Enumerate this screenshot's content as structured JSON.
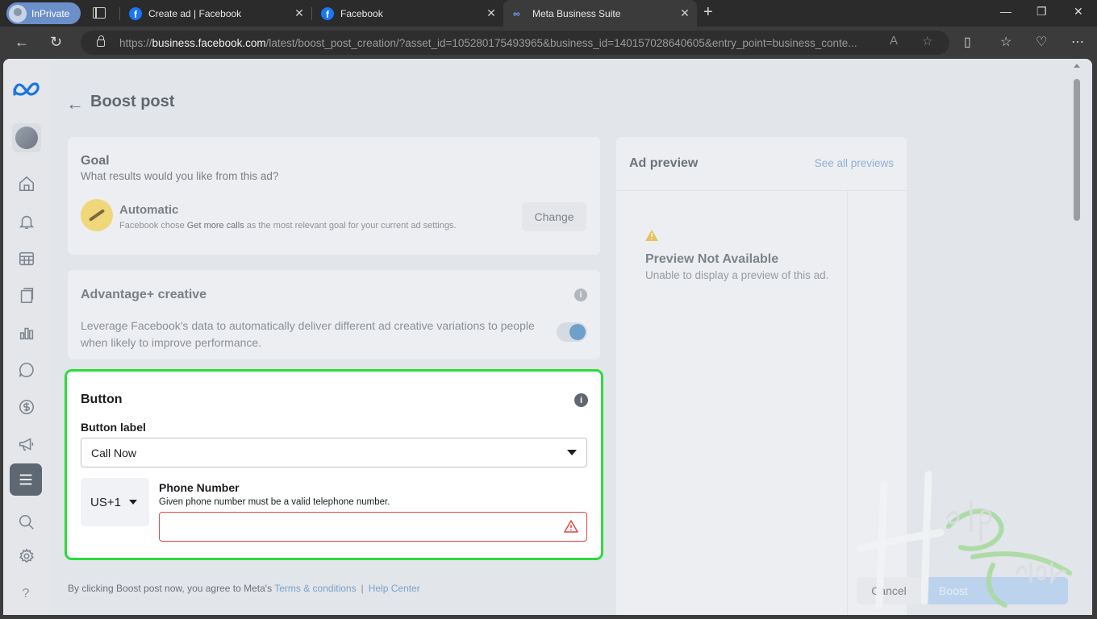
{
  "browser": {
    "inprivate_label": "InPrivate",
    "tabs": [
      {
        "title": "Create ad | Facebook",
        "close": "✕"
      },
      {
        "title": "Facebook",
        "close": "✕"
      },
      {
        "title": "Meta Business Suite",
        "close": "✕"
      }
    ],
    "new_tab": "+",
    "url_prefix": "https://",
    "url_host": "business.facebook.com",
    "url_path": "/latest/boost_post_creation/?asset_id=105280175493965&business_id=140157028640605&entry_point=business_conte..."
  },
  "page": {
    "title": "Boost post",
    "goal": {
      "heading": "Goal",
      "question": "What results would you like from this ad?",
      "option": "Automatic",
      "desc_prefix": "Facebook chose ",
      "desc_bold": "Get more calls",
      "desc_suffix": " as the most relevant goal for your current ad settings.",
      "change_label": "Change"
    },
    "advantage": {
      "heading": "Advantage+ creative",
      "description": "Leverage Facebook's data to automatically deliver different ad creative variations to people when likely to improve performance.",
      "toggle_on": true
    },
    "button_section": {
      "heading": "Button",
      "label_heading": "Button label",
      "selected_label": "Call Now",
      "country_code": "US+1",
      "phone_heading": "Phone Number",
      "phone_hint": "Given phone number must be a valid telephone number.",
      "phone_value": "",
      "highlight_color": "#2bdc3b"
    },
    "preview": {
      "heading": "Ad preview",
      "see_all": "See all previews",
      "na_title": "Preview Not Available",
      "na_sub": "Unable to display a preview of this ad."
    },
    "footer": {
      "text": "By clicking Boost post now, you agree to Meta's ",
      "terms": "Terms & conditions",
      "separator": "|",
      "help": "Help Center",
      "cancel": "Cancel",
      "boost": "Boost"
    }
  },
  "icons": [
    "meta-logo-icon",
    "home-icon",
    "bell-icon",
    "table-icon",
    "pages-icon",
    "chart-icon",
    "chat-icon",
    "dollar-icon",
    "megaphone-icon",
    "menu-icon",
    "search-icon",
    "gear-icon",
    "help-icon"
  ],
  "watermark": "Help Guider"
}
